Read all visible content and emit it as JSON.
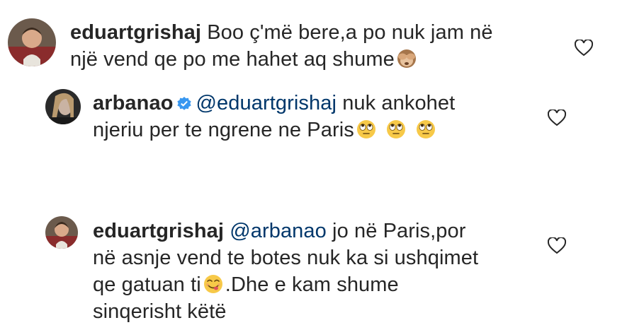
{
  "comments": [
    {
      "username": "eduartgrishaj",
      "line1": "Boo ç'më bere,a po nuk jam në",
      "line2": "një vend qe po me hahet aq shume",
      "emoji": "see-no-evil-monkey",
      "liked": false
    },
    {
      "username": "arbanao",
      "verified": true,
      "mention": "@eduartgrishaj",
      "line1_rest": "nuk ankohet",
      "line2": "njeriu per te ngrene ne Paris",
      "emoji": "face-with-rolling-eyes",
      "emoji_count": 3,
      "liked": false
    },
    {
      "username": "eduartgrishaj",
      "mention": "@arbanao",
      "line1_rest": "jo në Paris,por",
      "line2": "në asnje vend te botes nuk ka si ushqimet",
      "line3_before": "qe gatuan ti",
      "emoji": "face-savoring-food",
      "line3_after": ".Dhe e kam shume",
      "line4": "sinqerisht këtë",
      "liked": false
    }
  ],
  "colors": {
    "text": "#262626",
    "mention": "#00376b",
    "verified": "#3897f0",
    "heart_outline": "#262626"
  }
}
